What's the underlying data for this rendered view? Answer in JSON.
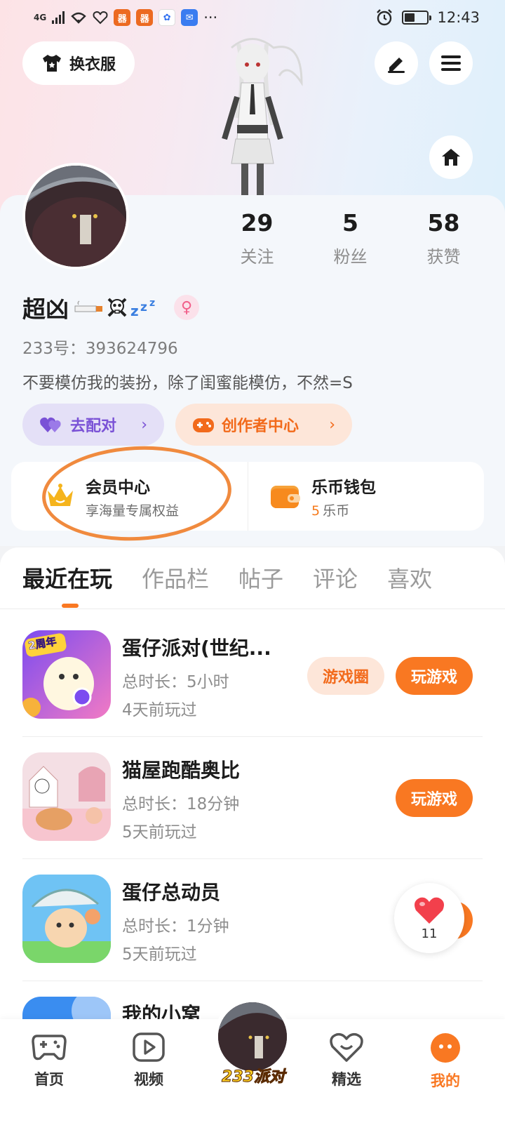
{
  "status_bar": {
    "network": "4G",
    "time": "12:43",
    "notification_apps": [
      "app-icon",
      "app-icon",
      "paw-icon",
      "mail-icon"
    ],
    "more": "···"
  },
  "header": {
    "outfit_button": "换衣服",
    "edit_icon": "edit-icon",
    "menu_icon": "menu-icon",
    "home_icon": "home-icon"
  },
  "profile": {
    "stats": [
      {
        "value": "29",
        "label": "关注"
      },
      {
        "value": "5",
        "label": "粉丝"
      },
      {
        "value": "58",
        "label": "获赞"
      }
    ],
    "nickname": "超凶",
    "nickname_emojis": [
      "cigarette-icon",
      "skull-crossbones-icon",
      "zzz-icon"
    ],
    "gender": "♀",
    "uid": "233号：393624796",
    "bio": "不要模仿我的装扮，除了闺蜜能模仿，不然=S",
    "match_button": "去配对",
    "creator_button": "创作者中心"
  },
  "vip": {
    "title": "会员中心",
    "subtitle": "享海量专属权益"
  },
  "wallet": {
    "title": "乐币钱包",
    "amount": "5",
    "unit": "乐币"
  },
  "tabs": [
    {
      "label": "最近在玩",
      "active": true
    },
    {
      "label": "作品栏",
      "active": false
    },
    {
      "label": "帖子",
      "active": false
    },
    {
      "label": "评论",
      "active": false
    },
    {
      "label": "喜欢",
      "active": false
    }
  ],
  "games": [
    {
      "name": "蛋仔派对(世纪...",
      "duration": "总时长：5小时",
      "last_played": "4天前玩过",
      "circle_button": "游戏圈",
      "play_button": "玩游戏",
      "icon_badge": "2周年"
    },
    {
      "name": "猫屋跑酷奥比",
      "duration": "总时长：18分钟",
      "last_played": "5天前玩过",
      "play_button": "玩游戏"
    },
    {
      "name": "蛋仔总动员",
      "duration": "总时长：1分钟",
      "last_played": "5天前玩过"
    },
    {
      "name": "我的小窝"
    }
  ],
  "like_float": {
    "count": "11"
  },
  "bottom_nav": [
    {
      "label": "首页",
      "icon": "gamepad-icon",
      "active": false
    },
    {
      "label": "视频",
      "icon": "video-play-icon",
      "active": false
    },
    {
      "label": "233派对",
      "icon": "party-avatar",
      "active": false
    },
    {
      "label": "精选",
      "icon": "heart-chat-icon",
      "active": false
    },
    {
      "label": "我的",
      "icon": "profile-face-icon",
      "active": true
    }
  ],
  "colors": {
    "accent": "#f97822",
    "vip_gold": "#f5b41d",
    "match_purple": "#7a52d6",
    "annotation_orange": "#f08a3e"
  }
}
